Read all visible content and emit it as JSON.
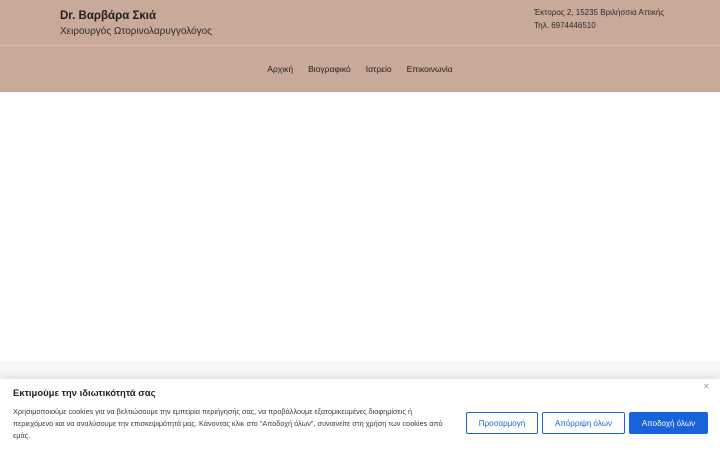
{
  "header": {
    "brand_name": "Dr. Βαρβάρα Σκιά",
    "brand_subtitle": "Χειρουργός Ωτορινολαρυγγολόγος",
    "address": "Έκτορος 2, 15235 Βριλήσσια Αττικής",
    "phone": "Τηλ. 6974446510",
    "background_color": "#c9a999"
  },
  "nav": {
    "items": [
      {
        "label": "Αρχική"
      },
      {
        "label": "Βιογραφικό"
      },
      {
        "label": "Ιατρείο"
      },
      {
        "label": "Επικοινωνία"
      }
    ]
  },
  "cookie_banner": {
    "title": "Εκτιμούμε την ιδιωτικότητά σας",
    "text": "Χρησιμοποιούμε cookies για να βελτιώσουμε την εμπειρία περιήγησής σας, να προβάλλουμε εξατομικευμένες διαφημίσεις ή περιεχόμενο και να αναλύσουμε την επισκεψιμότητά μας. Κάνοντας κλικ στο \"Αποδοχή όλων\", συναινείτε στη χρήση των cookies από εμάς.",
    "close_icon": "close-icon",
    "customize_label": "Προσαρμογή",
    "reject_label": "Απόρριψη όλων",
    "accept_label": "Αποδοχή όλων",
    "accent_color": "#1863dc"
  }
}
